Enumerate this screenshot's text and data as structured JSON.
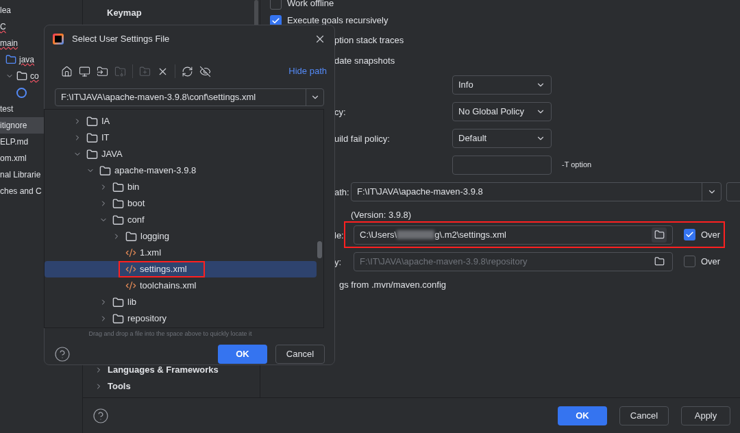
{
  "project_tree": [
    {
      "label": "lea",
      "error": false,
      "selected": false
    },
    {
      "label": "C",
      "error": true,
      "selected": false
    },
    {
      "label": "main",
      "error": true,
      "selected": false,
      "children": [
        {
          "label": "java",
          "kind": "source_folder",
          "error": true,
          "selected": false
        },
        {
          "label": "co",
          "kind": "open_folder",
          "error": true,
          "selected": false,
          "children": [
            {
              "kind": "class",
              "selected": false
            }
          ]
        }
      ]
    },
    {
      "label": "test",
      "error": false,
      "selected": false
    },
    {
      "label": "itignore",
      "error": false,
      "selected": true
    },
    {
      "label": "ELP.md",
      "error": false,
      "selected": false
    },
    {
      "label": "om.xml",
      "error": false,
      "selected": false
    },
    {
      "label": "nal Librarie",
      "error": false,
      "selected": false
    },
    {
      "label": "ches and C",
      "error": false,
      "selected": false
    }
  ],
  "settings_sidebar": {
    "top_items": [
      {
        "label": "Keymap",
        "expandable": false
      }
    ],
    "bottom_items": [
      {
        "label": "Languages & Frameworks",
        "expandable": true
      },
      {
        "label": "Tools",
        "expandable": true
      }
    ]
  },
  "maven_settings": [
    {
      "kind": "checkbox",
      "label": "Work offline",
      "checked": false
    },
    {
      "kind": "checkbox",
      "label": "Execute goals recursively",
      "checked": true
    },
    {
      "kind": "covered",
      "label": "ption stack traces"
    },
    {
      "kind": "covered",
      "label": "date snapshots"
    },
    {
      "kind": "select",
      "value": "Info"
    },
    {
      "kind": "select",
      "label": "cy:",
      "value": "No Global Policy"
    },
    {
      "kind": "select",
      "label": "uild fail policy:",
      "value": "Default"
    },
    {
      "kind": "input",
      "suffix": "-T option"
    },
    {
      "kind": "combo",
      "label": "ath:",
      "value": "F:\\IT\\JAVA\\apache-maven-3.9.8"
    },
    {
      "kind": "version",
      "label": "(Version: 3.9.8)"
    },
    {
      "kind": "file",
      "label": "le:",
      "value_start": "C:\\Users\\",
      "redacted": true,
      "value_end": "g\\.m2\\settings.xml",
      "disabled": false,
      "override": {
        "label": "Over",
        "checked": true
      },
      "annotated": true
    },
    {
      "kind": "file",
      "label": "y:",
      "value_start": "F:\\IT\\JAVA\\apache-maven-3.9.8\\repository",
      "disabled": true,
      "override": {
        "label": "Over",
        "checked": false
      },
      "annotated": false
    },
    {
      "kind": "note",
      "label": "gs from .mvn/maven.config"
    }
  ],
  "settings_buttons": [
    {
      "label": "OK",
      "primary": true
    },
    {
      "label": "Cancel",
      "primary": false
    },
    {
      "label": "Apply",
      "primary": false
    }
  ],
  "dialog": {
    "title": "Select User Settings File",
    "hide_path": "Hide path",
    "path": "F:\\IT\\JAVA\\apache-maven-3.9.8\\conf\\settings.xml",
    "toolbar_groups": [
      {
        "buttons": [
          {
            "disabled": false
          },
          {
            "disabled": false
          },
          {
            "disabled": false
          },
          {
            "disabled": true
          }
        ]
      },
      {
        "buttons": [
          {
            "disabled": true
          },
          {
            "disabled": false
          }
        ]
      },
      {
        "buttons": [
          {
            "disabled": false
          },
          {
            "disabled": false
          }
        ]
      }
    ],
    "tree": [
      {
        "label": "IA",
        "kind": "folder",
        "expanded": false,
        "selected": false,
        "annotated": false
      },
      {
        "label": "IT",
        "kind": "folder",
        "expanded": false,
        "selected": false,
        "annotated": false
      },
      {
        "label": "JAVA",
        "kind": "folder",
        "expanded": true,
        "selected": false,
        "annotated": false,
        "children": [
          {
            "label": "apache-maven-3.9.8",
            "kind": "folder",
            "expanded": true,
            "selected": false,
            "annotated": false,
            "children": [
              {
                "label": "bin",
                "kind": "folder",
                "expanded": false,
                "selected": false,
                "annotated": false
              },
              {
                "label": "boot",
                "kind": "folder",
                "expanded": false,
                "selected": false,
                "annotated": false
              },
              {
                "label": "conf",
                "kind": "folder",
                "expanded": true,
                "selected": false,
                "annotated": false,
                "children": [
                  {
                    "label": "logging",
                    "kind": "folder",
                    "expanded": false,
                    "selected": false,
                    "annotated": false
                  },
                  {
                    "label": "1.xml",
                    "kind": "xml",
                    "selected": false,
                    "annotated": false
                  },
                  {
                    "label": "settings.xml",
                    "kind": "xml",
                    "selected": true,
                    "annotated": true
                  },
                  {
                    "label": "toolchains.xml",
                    "kind": "xml",
                    "selected": false,
                    "annotated": false
                  }
                ]
              },
              {
                "label": "lib",
                "kind": "folder",
                "expanded": false,
                "selected": false,
                "annotated": false
              },
              {
                "label": "repository",
                "kind": "folder",
                "expanded": false,
                "selected": false,
                "annotated": false
              }
            ]
          }
        ]
      }
    ],
    "hint": "Drag and drop a file into the space above to quickly locate it",
    "buttons": [
      {
        "label": "OK",
        "primary": true
      },
      {
        "label": "Cancel",
        "primary": false
      }
    ]
  }
}
